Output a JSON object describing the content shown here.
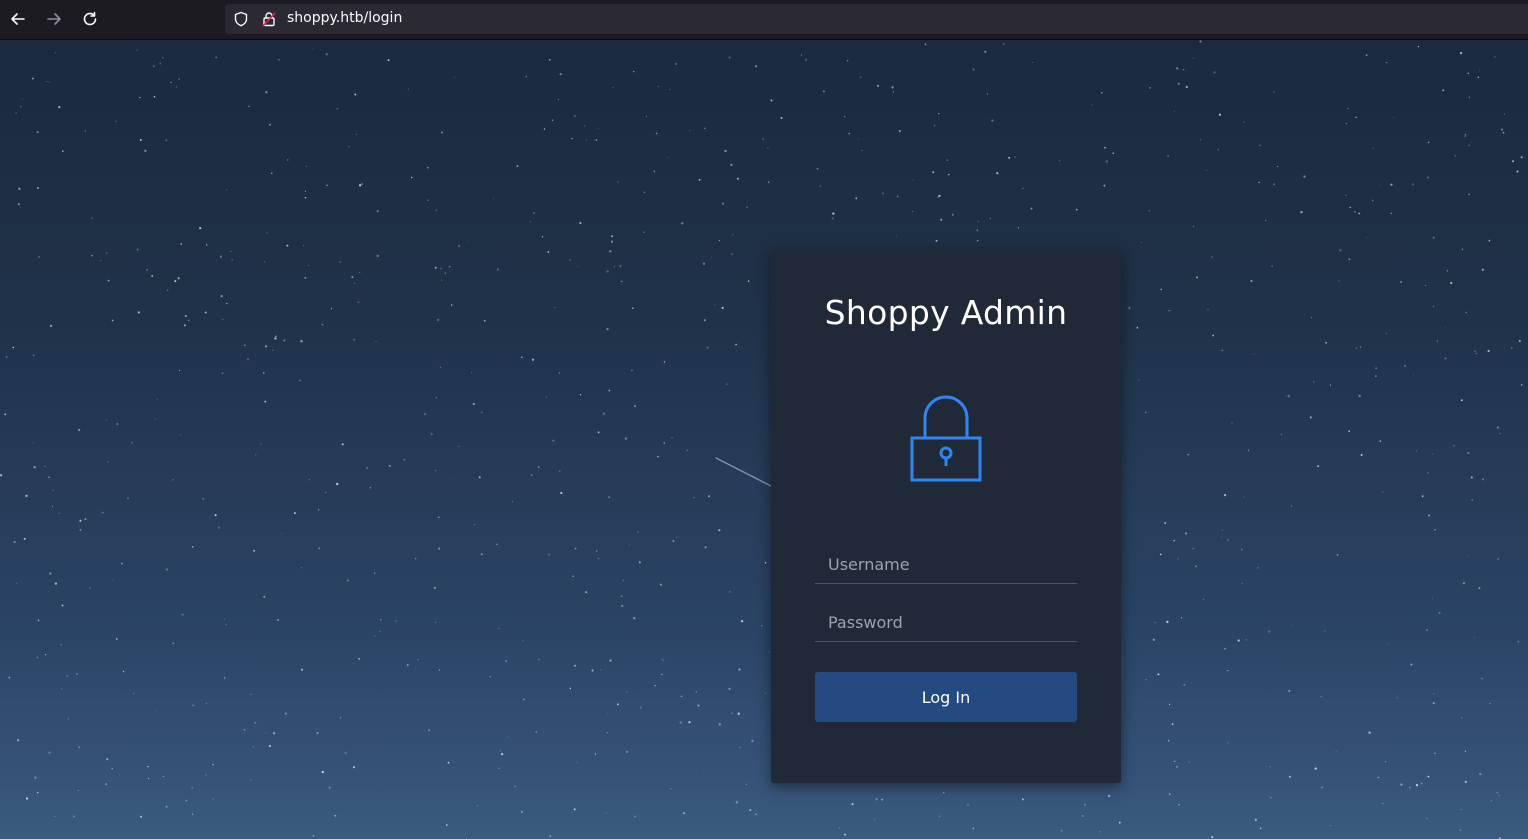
{
  "browser": {
    "back_icon": "arrow-left-icon",
    "forward_icon": "arrow-right-icon",
    "reload_icon": "reload-icon",
    "url": "shoppy.htb/login",
    "colors": {
      "toolbar_bg": "#1c1b22",
      "urlbar_bg": "#2b2a33"
    }
  },
  "login": {
    "title": "Shoppy Admin",
    "icon": "padlock-icon",
    "username_placeholder": "Username",
    "password_placeholder": "Password",
    "submit_label": "Log In",
    "colors": {
      "card_bg": "#1f2937",
      "accent": "#2f86f0",
      "button_bg": "#234b82"
    }
  }
}
